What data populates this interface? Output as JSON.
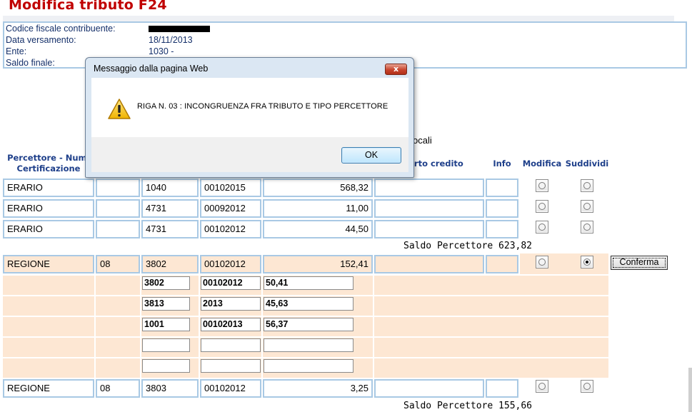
{
  "page": {
    "title": "Modifica tributo F24"
  },
  "info": {
    "rows": [
      {
        "label": "Codice fiscale contribuente:",
        "value": ""
      },
      {
        "label": "Data versamento:",
        "value": "18/11/2013"
      },
      {
        "label": "Ente:",
        "value": "1030 -"
      },
      {
        "label": "Saldo finale:",
        "value": ""
      }
    ]
  },
  "background_fragment": "ocali",
  "table": {
    "headers": {
      "percettore": "Percettore - Num. Certificazione",
      "importo_credito": "orto credito",
      "info": "Info",
      "modifica": "Modifica",
      "suddividi": "Suddividi"
    },
    "rows": [
      {
        "percettore": "ERARIO",
        "num": "",
        "tributo": "1040",
        "riferimento": "00102015",
        "importo": "568,32",
        "credito": "",
        "info": "",
        "modifica": false,
        "suddividi": false
      },
      {
        "percettore": "ERARIO",
        "num": "",
        "tributo": "4731",
        "riferimento": "00092012",
        "importo": "11,00",
        "credito": "",
        "info": "",
        "modifica": false,
        "suddividi": false
      },
      {
        "percettore": "ERARIO",
        "num": "",
        "tributo": "4731",
        "riferimento": "00102012",
        "importo": "44,50",
        "credito": "",
        "info": "",
        "modifica": false,
        "suddividi": false
      },
      {
        "percettore": "REGIONE",
        "num": "08",
        "tributo": "3802",
        "riferimento": "00102012",
        "importo": "152,41",
        "credito": "",
        "info": "",
        "modifica": false,
        "suddividi": true
      },
      {
        "percettore": "REGIONE",
        "num": "08",
        "tributo": "3803",
        "riferimento": "00102012",
        "importo": "3,25",
        "credito": "",
        "info": "",
        "modifica": false,
        "suddividi": false
      }
    ],
    "saldo_erario": "Saldo Percettore 623,82",
    "saldo_regione": "Saldo Percettore 155,66",
    "split_rows": [
      {
        "tributo": "3802",
        "riferimento": "00102012",
        "importo": "50,41"
      },
      {
        "tributo": "3813",
        "riferimento": "2013",
        "importo": "45,63"
      },
      {
        "tributo": "1001",
        "riferimento": "00102013",
        "importo": "56,37"
      },
      {
        "tributo": "",
        "riferimento": "",
        "importo": ""
      },
      {
        "tributo": "",
        "riferimento": "",
        "importo": ""
      }
    ],
    "confirm_label": "Conferma"
  },
  "dialog": {
    "title": "Messaggio dalla pagina Web",
    "message": "RIGA N. 03 : INCONGRUENZA FRA TRIBUTO E TIPO PERCETTORE",
    "ok_label": "OK",
    "close_glyph": "x",
    "icon": "warning-icon"
  },
  "colors": {
    "title": "#c00000",
    "border": "#a9c9e4",
    "header_text": "#1e3f8a",
    "highlight_row": "#fde7d3"
  }
}
